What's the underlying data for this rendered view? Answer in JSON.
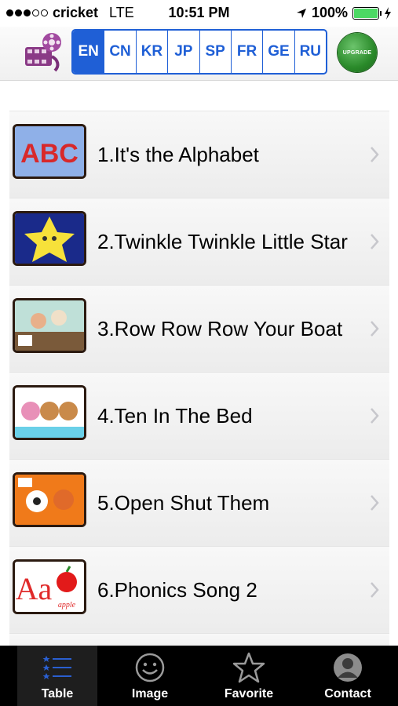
{
  "status": {
    "carrier": "cricket",
    "network": "LTE",
    "time": "10:51 PM",
    "battery": "100%",
    "battery_level": 1.0
  },
  "toolbar": {
    "languages": [
      "EN",
      "CN",
      "KR",
      "JP",
      "SP",
      "FR",
      "GE",
      "RU"
    ],
    "selected_language": "EN",
    "upgrade_label": "UPGRADE",
    "accent_color": "#1f5fd6"
  },
  "songs": [
    {
      "title": "1.It's the Alphabet",
      "thumb_label": "ABC"
    },
    {
      "title": "2.Twinkle Twinkle Little Star"
    },
    {
      "title": "3.Row Row Row Your Boat"
    },
    {
      "title": "4.Ten In The Bed"
    },
    {
      "title": "5.Open Shut Them"
    },
    {
      "title": "6.Phonics Song 2",
      "thumb_label": "Aa",
      "thumb_caption": "apple"
    }
  ],
  "tabs": [
    {
      "label": "Table",
      "icon": "list-icon"
    },
    {
      "label": "Image",
      "icon": "smiley-icon"
    },
    {
      "label": "Favorite",
      "icon": "star-icon"
    },
    {
      "label": "Contact",
      "icon": "person-icon"
    }
  ]
}
